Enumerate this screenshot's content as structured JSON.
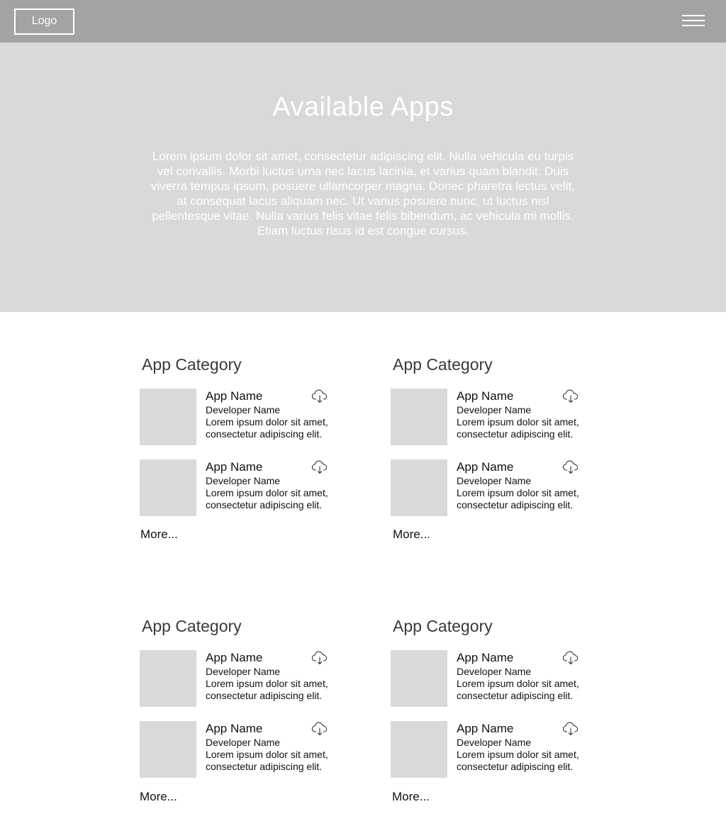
{
  "header": {
    "logo_label": "Logo",
    "menu_icon": "hamburger-menu-icon"
  },
  "hero": {
    "title": "Available Apps",
    "description": "Lorem ipsum dolor sit amet, consectetur adipiscing elit. Nulla vehicula eu turpis vel convallis. Morbi luctus urna nec lacus lacinia, et varius quam blandit. Duis viverra tempus ipsum, posuere ullamcorper magna. Donec pharetra lectus velit, at consequat lacus aliquam nec. Ut varius posuere nunc, ut luctus nisl pellentesque vitae. Nulla varius felis vitae felis bibendum, ac vehicula mi mollis. Etiam luctus risus id est congue cursus."
  },
  "colors": {
    "header_bg": "#a3a3a3",
    "hero_bg": "#d9d9d9",
    "placeholder": "#d9d9d9"
  },
  "categories": [
    {
      "title": "App Category",
      "more_label": "More...",
      "apps": [
        {
          "name": "App Name",
          "developer": "Developer Name",
          "description": "Lorem ipsum dolor sit amet, consectetur adipiscing elit.",
          "icon": "cloud-download-icon"
        },
        {
          "name": "App Name",
          "developer": "Developer Name",
          "description": "Lorem ipsum dolor sit amet, consectetur adipiscing elit.",
          "icon": "cloud-download-icon"
        }
      ]
    },
    {
      "title": "App Category",
      "more_label": "More...",
      "apps": [
        {
          "name": "App Name",
          "developer": "Developer Name",
          "description": "Lorem ipsum dolor sit amet, consectetur adipiscing elit.",
          "icon": "cloud-download-icon"
        },
        {
          "name": "App Name",
          "developer": "Developer Name",
          "description": "Lorem ipsum dolor sit amet, consectetur adipiscing elit.",
          "icon": "cloud-download-icon"
        }
      ]
    },
    {
      "title": "App Category",
      "more_label": "More...",
      "apps": [
        {
          "name": "App Name",
          "developer": "Developer Name",
          "description": "Lorem ipsum dolor sit amet, consectetur adipiscing elit.",
          "icon": "cloud-download-icon"
        },
        {
          "name": "App Name",
          "developer": "Developer Name",
          "description": "Lorem ipsum dolor sit amet, consectetur adipiscing elit.",
          "icon": "cloud-download-icon"
        }
      ]
    },
    {
      "title": "App Category",
      "more_label": "More...",
      "apps": [
        {
          "name": "App Name",
          "developer": "Developer Name",
          "description": "Lorem ipsum dolor sit amet, consectetur adipiscing elit.",
          "icon": "cloud-download-icon"
        },
        {
          "name": "App Name",
          "developer": "Developer Name",
          "description": "Lorem ipsum dolor sit amet, consectetur adipiscing elit.",
          "icon": "cloud-download-icon"
        }
      ]
    }
  ]
}
